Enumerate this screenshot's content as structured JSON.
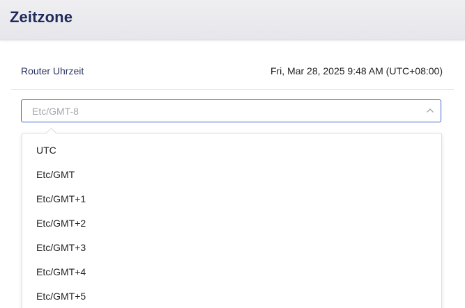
{
  "header": {
    "title": "Zeitzone"
  },
  "router_time": {
    "label": "Router Uhrzeit",
    "value": "Fri, Mar 28, 2025 9:48 AM (UTC+08:00)"
  },
  "timezone_select": {
    "selected": "Etc/GMT-8",
    "icon": "chevron-up-icon",
    "options": [
      "UTC",
      "Etc/GMT",
      "Etc/GMT+1",
      "Etc/GMT+2",
      "Etc/GMT+3",
      "Etc/GMT+4",
      "Etc/GMT+5"
    ]
  },
  "colors": {
    "title": "#1f2a5a",
    "select_border": "#3d63c9",
    "placeholder_text": "#a5a7ad"
  }
}
